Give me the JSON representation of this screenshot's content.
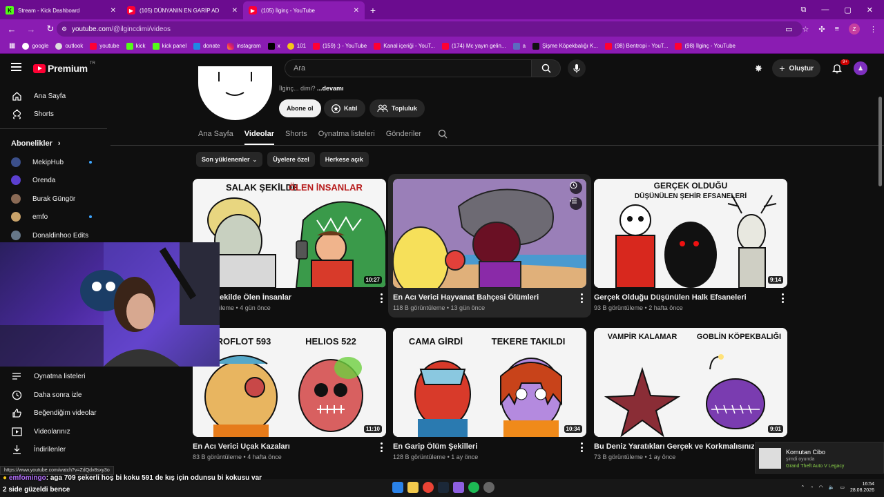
{
  "browser": {
    "tabs": [
      {
        "title": "Stream - Kick Dashboard",
        "favicon": "kick"
      },
      {
        "title": "(105) DÜNYANIN EN GARİP AD",
        "favicon": "yt"
      },
      {
        "title": "(105) İlginç - YouTube",
        "favicon": "yt"
      }
    ],
    "url_host": "youtube.com",
    "url_path": "/@ilgincdimi/videos",
    "profile_initial": "Z",
    "bookmarks": [
      "google",
      "outlook",
      "youtube",
      "kick",
      "kick panel",
      "donate",
      "instagram",
      "x",
      "101",
      "(159) ;) - YouTube",
      "Kanal içeriği - YouT...",
      "(174) Mc yayın gelin...",
      "a",
      "Şişme Köpekbalığı K...",
      "(98) Bentropi - YouT...",
      "(98) İlginç - YouTube"
    ]
  },
  "header": {
    "logo_text": "Premium",
    "country": "TR",
    "search_placeholder": "Ara",
    "create_label": "Oluştur",
    "notif_badge": "9+"
  },
  "sidebar": {
    "top": [
      {
        "label": "Ana Sayfa",
        "icon": "home-icon"
      },
      {
        "label": "Shorts",
        "icon": "shorts-icon"
      }
    ],
    "subs_heading": "Abonelikler",
    "subs": [
      {
        "label": "MekipHub",
        "color": "#3b4f8a",
        "dot": true
      },
      {
        "label": "Orenda",
        "color": "#5b3fd0",
        "dot": false
      },
      {
        "label": "Burak Güngör",
        "color": "#8a6a55",
        "dot": false
      },
      {
        "label": "emfo",
        "color": "#c9a36a",
        "dot": true
      },
      {
        "label": "Donaldinhoo Edits",
        "color": "#667788",
        "dot": false
      }
    ],
    "you": [
      {
        "label": "Oynatma listeleri",
        "icon": "playlist-icon"
      },
      {
        "label": "Daha sonra izle",
        "icon": "clock-icon"
      },
      {
        "label": "Beğendiğim videolar",
        "icon": "thumb-up-icon"
      },
      {
        "label": "Videolarınız",
        "icon": "video-icon"
      },
      {
        "label": "İndirilenler",
        "icon": "download-icon"
      }
    ]
  },
  "channel": {
    "desc_prefix": "İlginç... dimi?",
    "desc_more": "...devamı",
    "subscribe": "Abone ol",
    "join": "Katıl",
    "community": "Topluluk",
    "tabs": [
      "Ana Sayfa",
      "Videolar",
      "Shorts",
      "Oynatma listeleri",
      "Gönderiler"
    ],
    "active_tab": "Videolar",
    "chips": [
      "Son yüklenenler",
      "Üyelere özel",
      "Herkese açık"
    ]
  },
  "videos": [
    {
      "title": "Salak Şekilde Ölen İnsanlar",
      "views": "... görüntüleme",
      "age": "4 gün önce",
      "duration": "10:27",
      "thumb_text_1": "SALAK ŞEKİLDE ",
      "thumb_text_2": "ÖLEN İNSANLAR"
    },
    {
      "title": "En Acı Verici Hayvanat Bahçesi Ölümleri",
      "views": "118 B görüntüleme",
      "age": "13 gün önce",
      "duration": "",
      "thumb_text_1": "",
      "thumb_text_2": ""
    },
    {
      "title": "Gerçek Olduğu Düşünülen Halk Efsaneleri",
      "views": "93 B görüntüleme",
      "age": "2 hafta önce",
      "duration": "9:14",
      "thumb_text_1": "GERÇEK OLDUĞU",
      "thumb_text_2": "DÜŞÜNÜLEN ŞEHİR EFSANELERİ"
    },
    {
      "title": "En Acı Verici Uçak Kazaları",
      "views": "83 B görüntüleme",
      "age": "4 hafta önce",
      "duration": "11:10",
      "thumb_text_1": "AEROFLOT 593",
      "thumb_text_2": "HELIOS 522"
    },
    {
      "title": "En Garip Ölüm Şekilleri",
      "views": "128 B görüntüleme",
      "age": "1 ay önce",
      "duration": "10:34",
      "thumb_text_1": "CAMA GİRDİ",
      "thumb_text_2": "TEKERE TAKILDI"
    },
    {
      "title": "Bu Deniz Yaratıkları Gerçek ve Korkmalısınız Ben",
      "views": "73 B görüntüleme",
      "age": "1 ay önce",
      "duration": "9:01",
      "thumb_text_1": "VAMPİR KALAMAR",
      "thumb_text_2": "GOBLİN KÖPEKBALIĞI"
    }
  ],
  "overlay": {
    "status_url": "https://www.youtube.com/watch?v=ZdQdv8sxy3o",
    "chat_user": "emfomingo",
    "chat_text": ": aga 709 şekerli hoş bi koku 591 de kış için odunsu bi kokusu var",
    "chat_text2": "2 side güzeldi bence",
    "toast_name": "Komutan Cibo",
    "toast_status": "şimdi oyunda",
    "toast_game": "Grand Theft Auto V Legacy",
    "time": "16:54",
    "date": "28.08.2026"
  }
}
